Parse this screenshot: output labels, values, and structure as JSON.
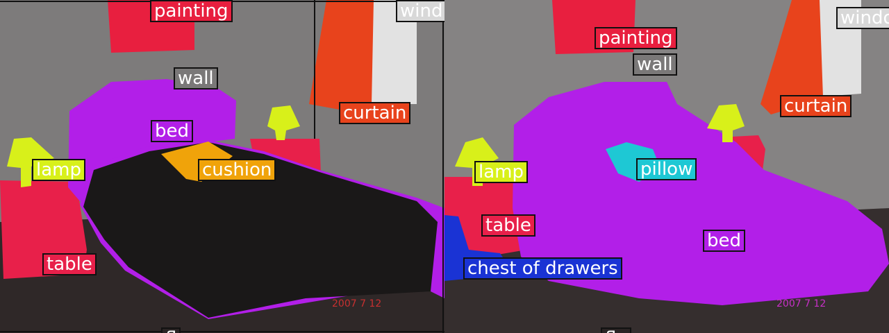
{
  "left_panel": {
    "labels": {
      "painting": "painting",
      "window": "wind",
      "wall": "wall",
      "curtain": "curtain",
      "bed": "bed",
      "lamp": "lamp",
      "cushion": "cushion",
      "table": "table",
      "floor": "fl"
    },
    "watermark": "2007 7 12"
  },
  "right_panel": {
    "labels": {
      "painting": "painting",
      "window": "windo",
      "wall": "wall",
      "curtain": "curtain",
      "pillow": "pillow",
      "lamp": "lamp",
      "table": "table",
      "bed": "bed",
      "chest_of_drawers": "chest of drawers",
      "floor": "flo"
    },
    "watermark": "2007 7 12"
  },
  "colors": {
    "wall": "#7a7878",
    "painting": "#e81f3f",
    "curtain": "#e8431c",
    "bed": "#b21fe8",
    "lamp": "#d8f01a",
    "cushion": "#f0a30a",
    "pillow": "#1ec8d4",
    "table": "#e8204a",
    "chest_of_drawers": "#1a33d4",
    "window": "#d8d8d8",
    "floor": "#2a2424"
  }
}
